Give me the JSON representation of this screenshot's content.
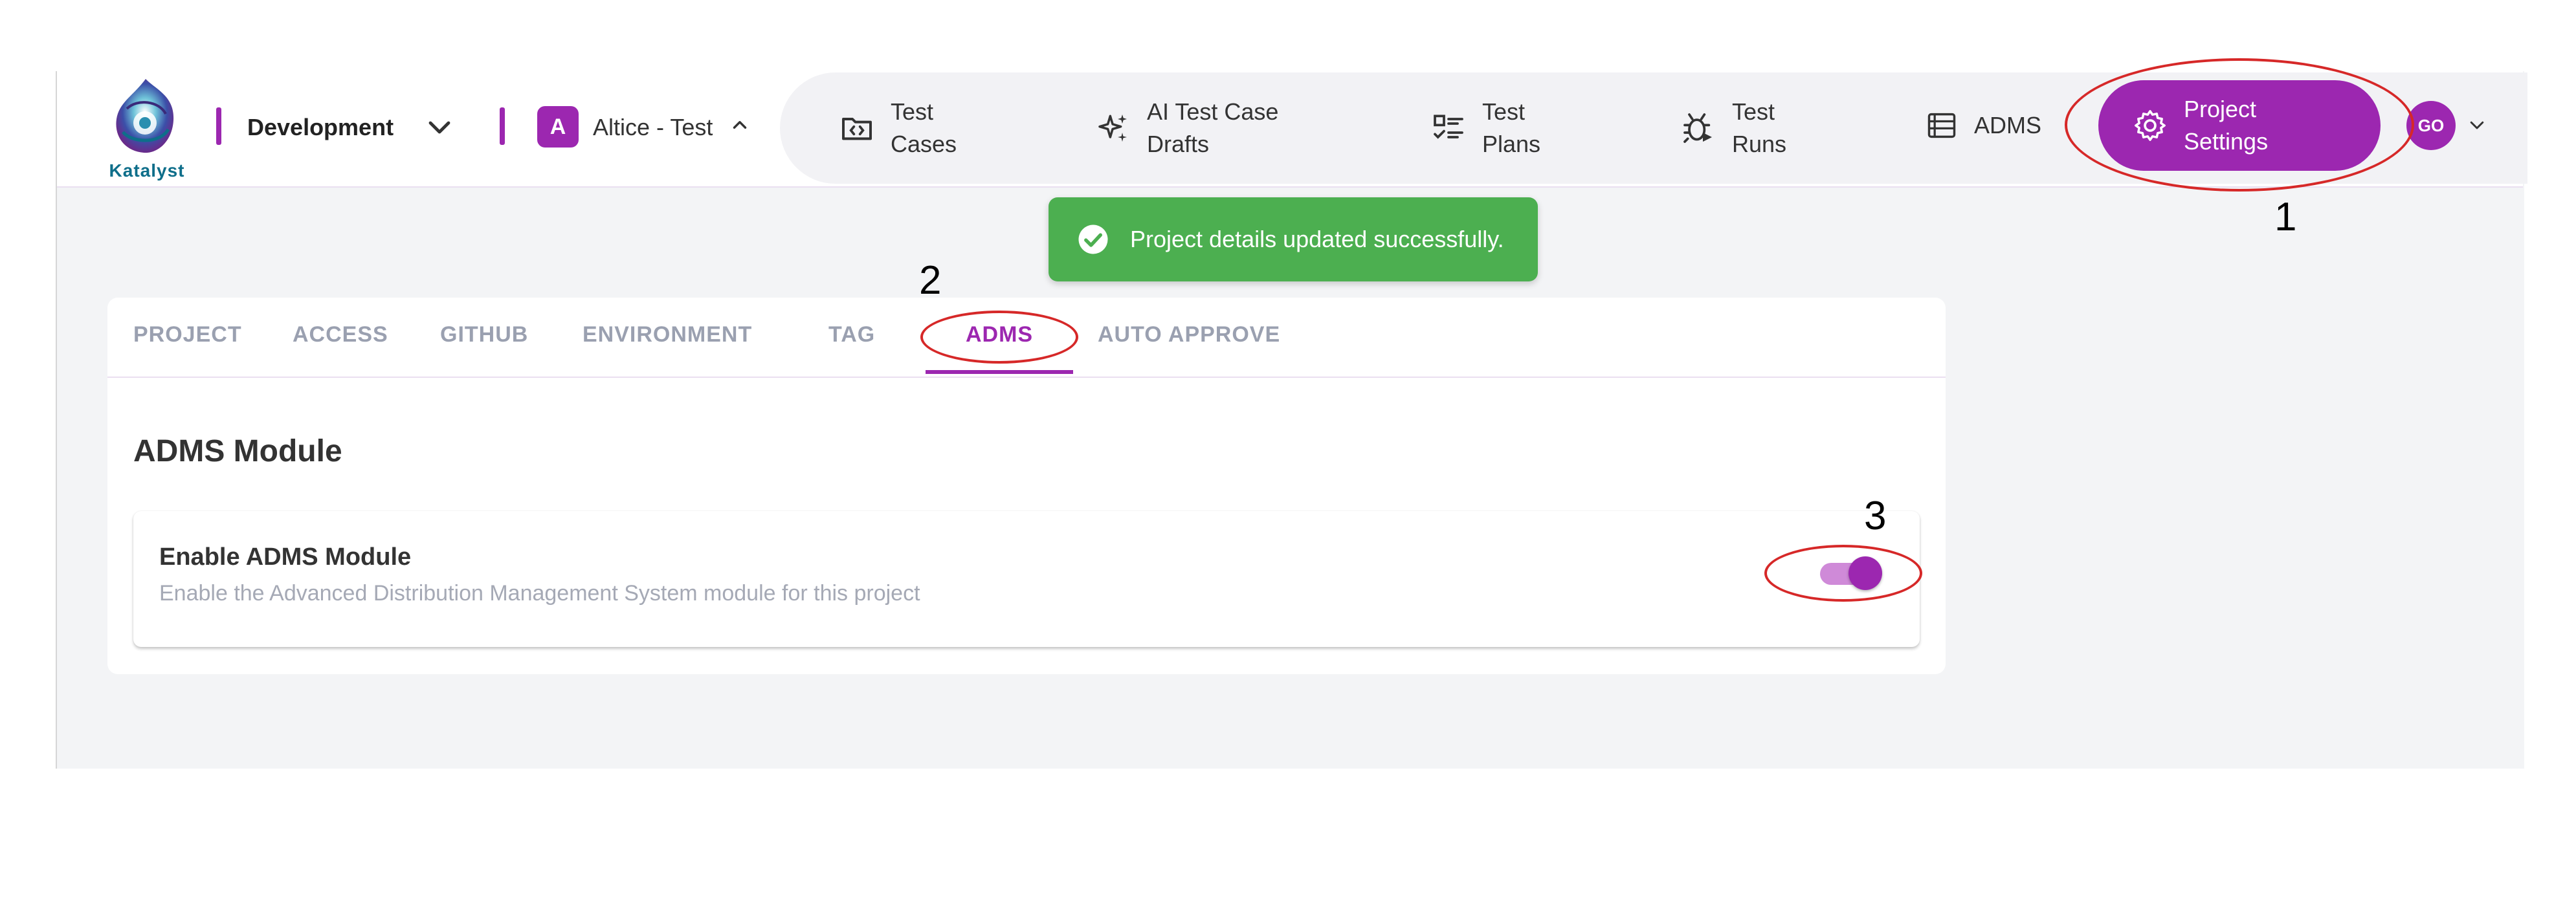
{
  "logo": {
    "text": "Katalyst"
  },
  "header": {
    "environment": "Development",
    "project_initial": "A",
    "project_name": "Altice - Test",
    "user_initials": "GO"
  },
  "nav": {
    "test_cases": [
      "Test",
      "Cases"
    ],
    "ai_drafts": [
      "AI Test Case",
      "Drafts"
    ],
    "test_plans": [
      "Test",
      "Plans"
    ],
    "test_runs": [
      "Test",
      "Runs"
    ],
    "adms": "ADMS",
    "project_settings": [
      "Project",
      "Settings"
    ]
  },
  "toast": {
    "message": "Project details updated successfully."
  },
  "tabs": [
    "PROJECT",
    "ACCESS",
    "GITHUB",
    "ENVIRONMENT",
    "TAG",
    "ADMS",
    "AUTO APPROVE"
  ],
  "active_tab": "ADMS",
  "section": {
    "title": "ADMS Module",
    "setting_title": "Enable ADMS Module",
    "setting_description": "Enable the Advanced Distribution Management System module for this project",
    "enabled": true
  },
  "annotations": [
    "1",
    "2",
    "3"
  ],
  "colors": {
    "accent": "#9c27b0",
    "toast": "#4caf50",
    "annotation": "#d62828"
  }
}
